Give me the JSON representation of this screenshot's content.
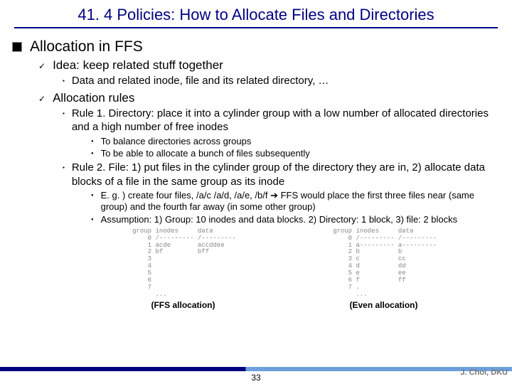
{
  "title": "41. 4 Policies: How to Allocate Files and Directories",
  "lvl1_1": "Allocation in FFS",
  "lvl2_1": "Idea: keep related stuff together",
  "lvl3_1": "Data and related inode, file and its related directory, …",
  "lvl2_2": "Allocation rules",
  "lvl3_2": "Rule 1. Directory: place it into a cylinder group with a low number of allocated directories and a high number of free inodes",
  "lvl4_1": "To balance directories across groups",
  "lvl4_2": "To be able to allocate a bunch of files subsequently",
  "lvl3_3": "Rule 2. File: 1) put files in the cylinder group of the directory they are in, 2) allocate data blocks of a file in the same group as its inode",
  "lvl4_3_a": "E. g. ) create four files, /a/c /a/d, /a/e, /b/f ",
  "lvl4_3_arrow": "➔",
  "lvl4_3_b": " FFS would place the first three files near (same group) and the fourth far away (in some other group)",
  "lvl4_4": "Assumption: 1) Group: 10 inodes and data blocks. 2) Directory: 1 block, 3) file: 2 blocks",
  "table1": "group inodes     data\n    0 /--------- /---------\n    1 acde       accddee\n    2 bf         bff\n    3\n    4\n    5\n    6\n    7\n      ...",
  "table2": "group inodes     data\n    0 /--------- /---------\n    1 a--------- a---------\n    2 b          b\n    3 c          cc\n    4 d          dd\n    5 e          ee\n    6 f          ff\n    7 .\n      ...",
  "caption1": "(FFS allocation)",
  "caption2": "(Even allocation)",
  "page": "33",
  "credit": "J. Choi, DKU",
  "chart_data": [
    {
      "type": "table",
      "title": "FFS allocation",
      "columns": [
        "group",
        "inodes",
        "data"
      ],
      "rows": [
        [
          "0",
          "/---------",
          "/---------"
        ],
        [
          "1",
          "acde",
          "accddee"
        ],
        [
          "2",
          "bf",
          "bff"
        ],
        [
          "3",
          "",
          ""
        ],
        [
          "4",
          "",
          ""
        ],
        [
          "5",
          "",
          ""
        ],
        [
          "6",
          "",
          ""
        ],
        [
          "7",
          "",
          ""
        ]
      ]
    },
    {
      "type": "table",
      "title": "Even allocation",
      "columns": [
        "group",
        "inodes",
        "data"
      ],
      "rows": [
        [
          "0",
          "/---------",
          "/---------"
        ],
        [
          "1",
          "a---------",
          "a---------"
        ],
        [
          "2",
          "b",
          "b"
        ],
        [
          "3",
          "c",
          "cc"
        ],
        [
          "4",
          "d",
          "dd"
        ],
        [
          "5",
          "e",
          "ee"
        ],
        [
          "6",
          "f",
          "ff"
        ],
        [
          "7",
          ".",
          ""
        ]
      ]
    }
  ]
}
